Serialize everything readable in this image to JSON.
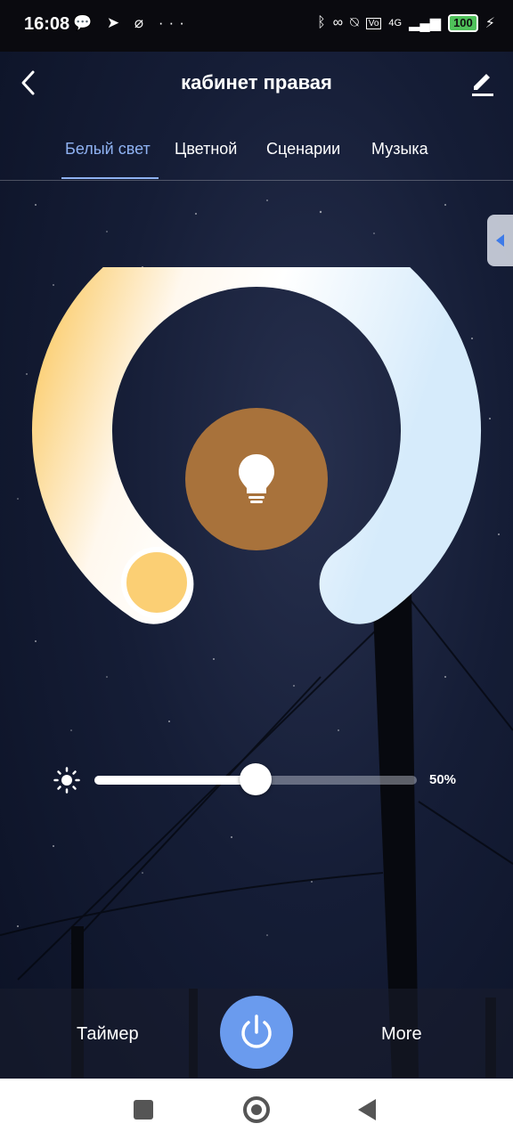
{
  "status_bar": {
    "time": "16:08",
    "left_icons": [
      "chat-icon",
      "telegram-icon",
      "app-icon",
      "more-dots-icon"
    ],
    "right_icons": [
      "bluetooth-icon",
      "link-icon",
      "vibrate-off-icon",
      "volte-icon",
      "signal-4g-icon"
    ],
    "network": "4G",
    "battery": "100"
  },
  "header": {
    "title": "кабинет правая",
    "back_icon": "chevron-left-icon",
    "edit_icon": "pencil-icon"
  },
  "tabs": [
    {
      "label": "Белый свет",
      "active": true
    },
    {
      "label": "Цветной",
      "active": false
    },
    {
      "label": "Сценарии",
      "active": false
    },
    {
      "label": "Музыка",
      "active": false
    }
  ],
  "accent_color": "#8fb2f2",
  "wheel": {
    "warm_color": "#fbcf74",
    "cool_color": "#d6ebfb",
    "bulb_color": "#a8723b",
    "bulb_icon": "lightbulb-icon"
  },
  "brightness": {
    "value": 0.5,
    "label": "50%",
    "icon": "sun-icon"
  },
  "bottom_bar": {
    "timer_label": "Таймер",
    "more_label": "More",
    "power_icon": "power-icon",
    "power_color": "#6a9bee"
  },
  "nav_bar": {
    "icons": [
      "recents-square-icon",
      "home-circle-icon",
      "back-triangle-icon"
    ]
  }
}
